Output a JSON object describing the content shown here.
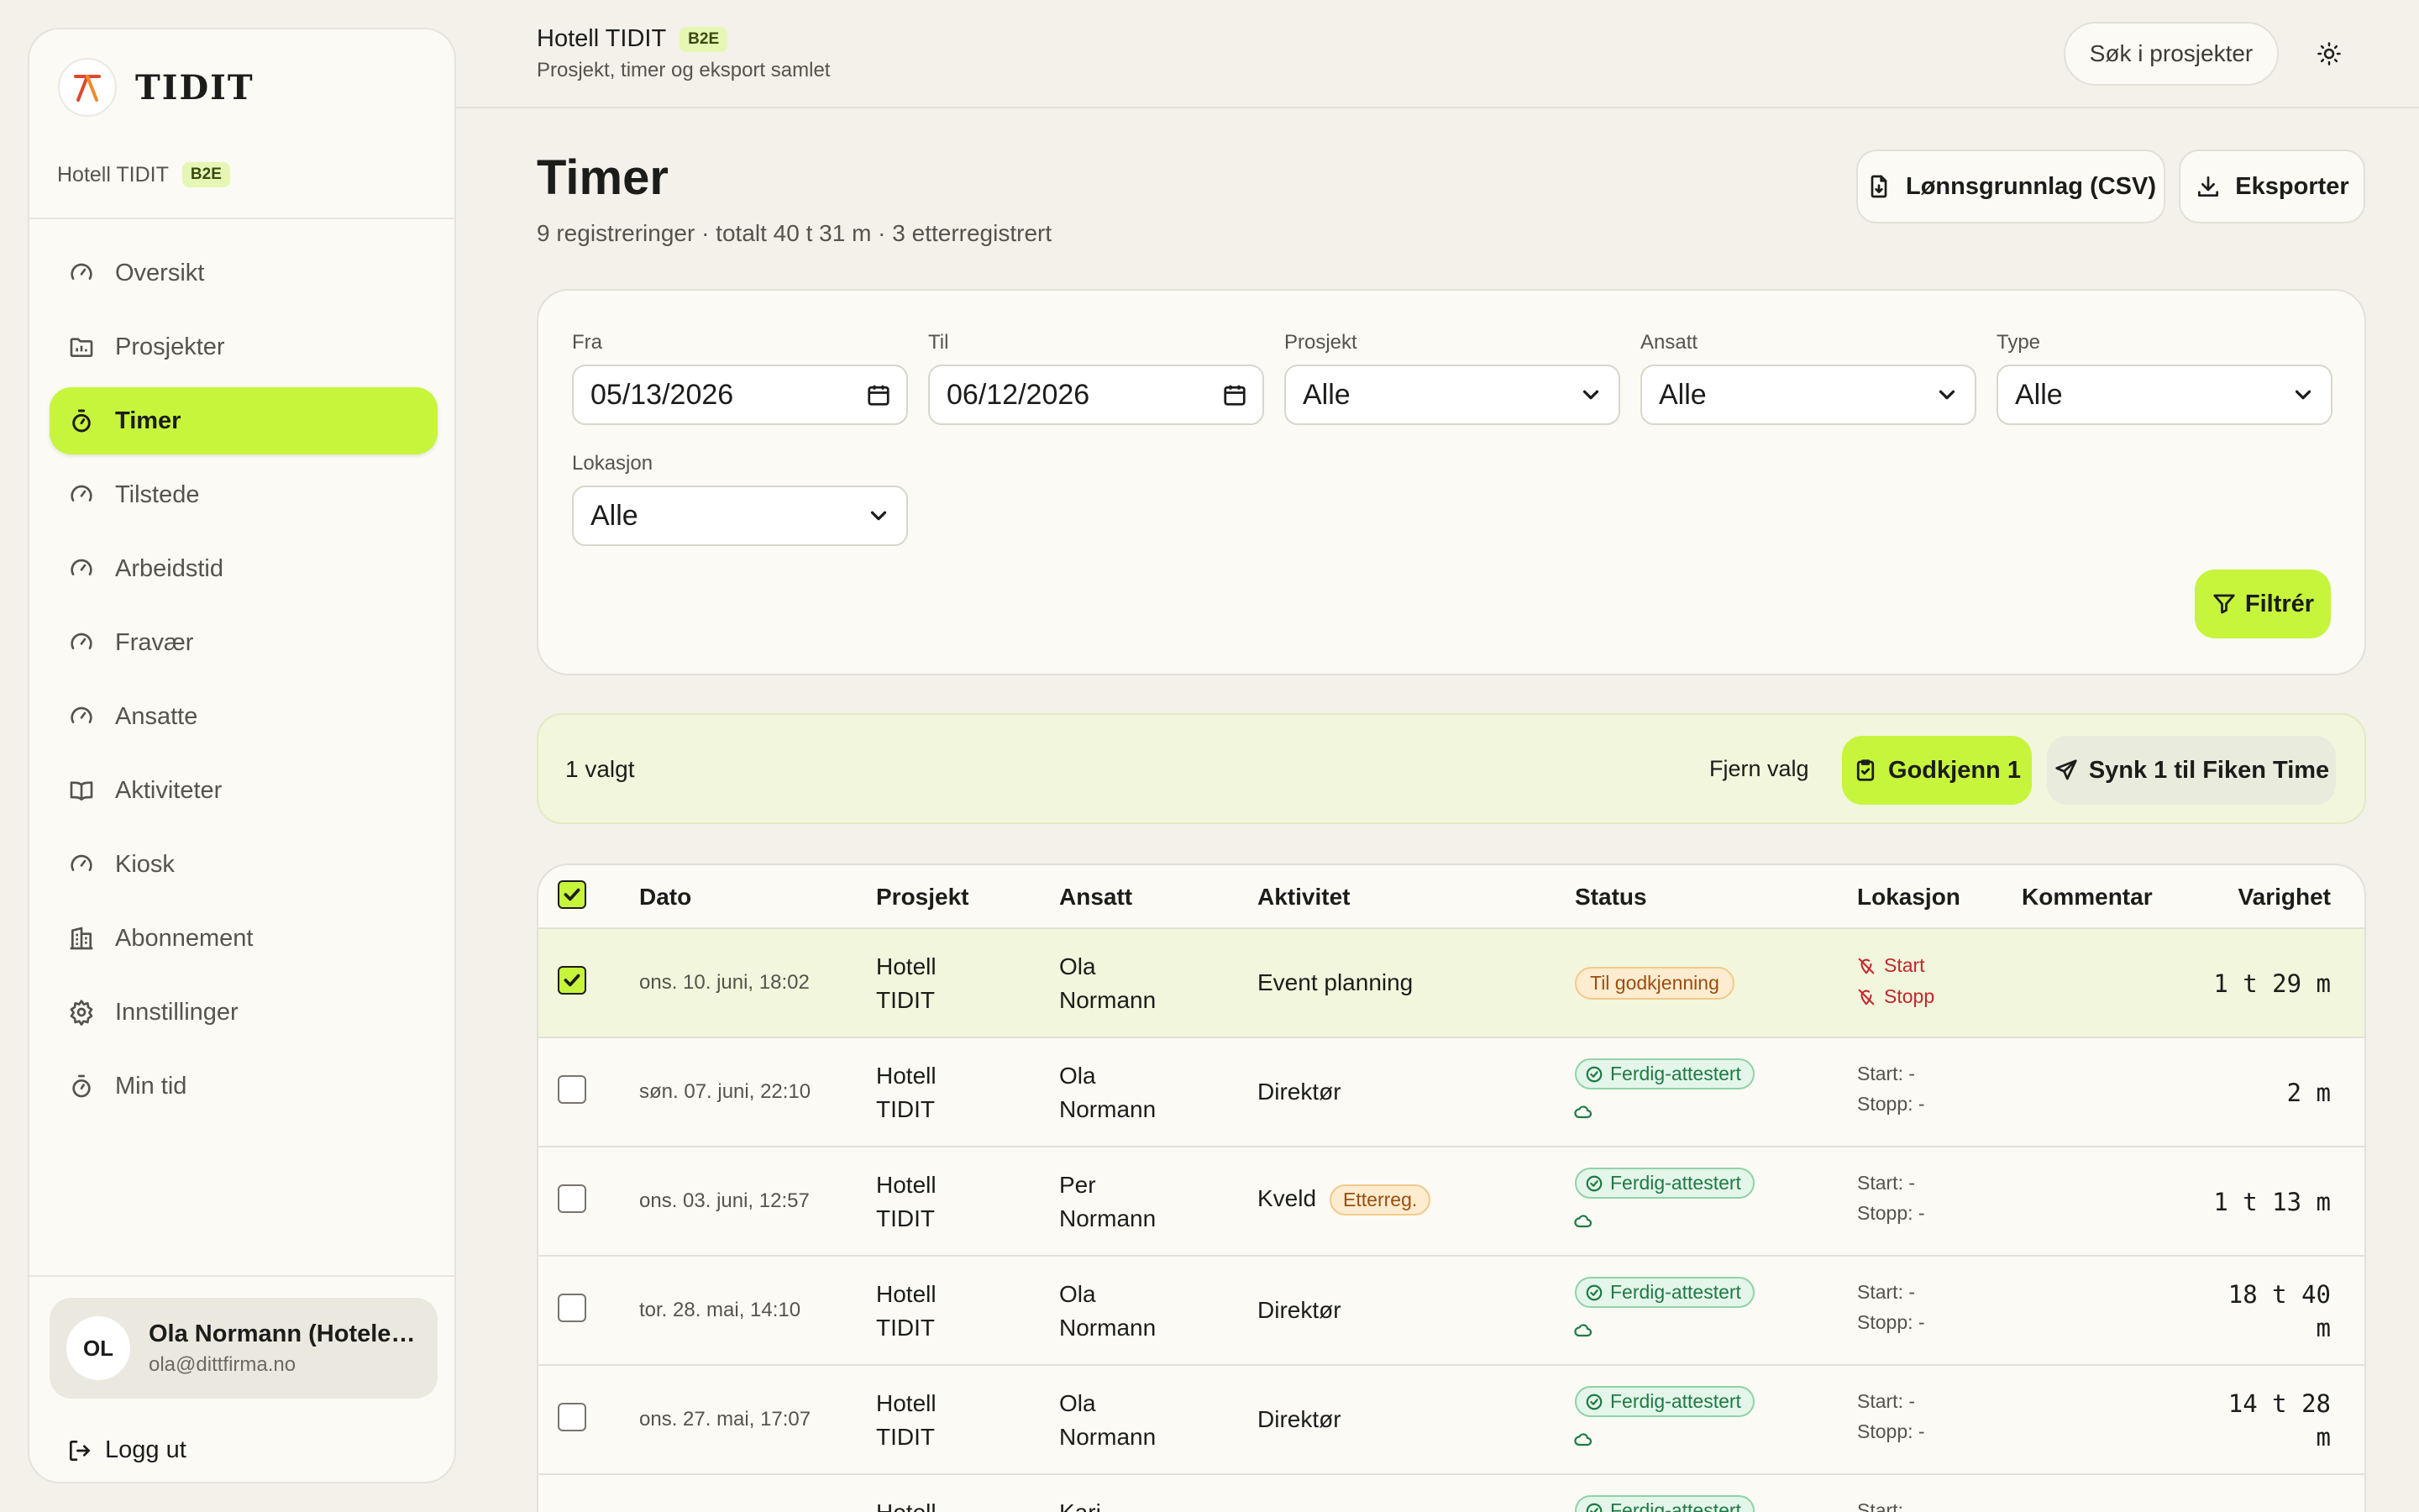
{
  "brand": {
    "name": "TIDIT",
    "org": "Hotell TIDIT",
    "badge": "B2E"
  },
  "sidebar": {
    "items": [
      {
        "label": "Oversikt",
        "icon": "gauge-icon"
      },
      {
        "label": "Prosjekter",
        "icon": "folder-chart-icon"
      },
      {
        "label": "Timer",
        "icon": "timer-icon",
        "active": true
      },
      {
        "label": "Tilstede",
        "icon": "gauge-icon"
      },
      {
        "label": "Arbeidstid",
        "icon": "gauge-icon"
      },
      {
        "label": "Fravær",
        "icon": "gauge-icon"
      },
      {
        "label": "Ansatte",
        "icon": "gauge-icon"
      },
      {
        "label": "Aktiviteter",
        "icon": "book-open-icon"
      },
      {
        "label": "Kiosk",
        "icon": "gauge-icon"
      },
      {
        "label": "Abonnement",
        "icon": "building-icon"
      },
      {
        "label": "Innstillinger",
        "icon": "gear-icon"
      },
      {
        "label": "Min tid",
        "icon": "timer-icon"
      }
    ],
    "user": {
      "initials": "OL",
      "name": "Ola Normann (Hotelei...",
      "email": "ola@dittfirma.no"
    },
    "logout_label": "Logg ut"
  },
  "topbar": {
    "title": "Hotell TIDIT",
    "badge": "B2E",
    "subtitle": "Prosjekt, timer og eksport samlet",
    "search_label": "Søk i prosjekter"
  },
  "page": {
    "title": "Timer",
    "subtitle": "9 registreringer · totalt 40 t 31 m · 3 etterregistrert",
    "payroll_button": "Lønnsgrunnlag (CSV)",
    "export_button": "Eksporter"
  },
  "filters": {
    "from_label": "Fra",
    "from_value": "05/13/2026",
    "to_label": "Til",
    "to_value": "06/12/2026",
    "project_label": "Prosjekt",
    "project_value": "Alle",
    "employee_label": "Ansatt",
    "employee_value": "Alle",
    "type_label": "Type",
    "type_value": "Alle",
    "location_label": "Lokasjon",
    "location_value": "Alle",
    "filter_button": "Filtrér"
  },
  "bulk": {
    "selected_text": "1 valgt",
    "clear_label": "Fjern valg",
    "approve_label": "Godkjenn 1",
    "sync_label": "Synk 1 til Fiken Time"
  },
  "table": {
    "columns": [
      "Dato",
      "Prosjekt",
      "Ansatt",
      "Aktivitet",
      "Status",
      "Lokasjon",
      "Kommentar",
      "Varighet"
    ],
    "rows": [
      {
        "date": "ons. 10. juni, 18:02",
        "project_l1": "Hotell",
        "project_l2": "TIDIT",
        "emp_l1": "Ola",
        "emp_l2": "Normann",
        "activity": "Event planning",
        "tag": "",
        "status": "Til godkjenning",
        "loc_start": "Start",
        "loc_stop": "Stopp",
        "comment": "",
        "dur_l1": "1 t 29 m",
        "dur_l2": ""
      },
      {
        "date": "søn. 07. juni, 22:10",
        "project_l1": "Hotell",
        "project_l2": "TIDIT",
        "emp_l1": "Ola",
        "emp_l2": "Normann",
        "activity": "Direktør",
        "tag": "",
        "status": "Ferdig-attestert",
        "loc_start": "Start: -",
        "loc_stop": "Stopp: -",
        "comment": "",
        "dur_l1": "2 m",
        "dur_l2": ""
      },
      {
        "date": "ons. 03. juni, 12:57",
        "project_l1": "Hotell",
        "project_l2": "TIDIT",
        "emp_l1": "Per",
        "emp_l2": "Normann",
        "activity": "Kveld",
        "tag": "Etterreg.",
        "status": "Ferdig-attestert",
        "loc_start": "Start: -",
        "loc_stop": "Stopp: -",
        "comment": "",
        "dur_l1": "1 t 13 m",
        "dur_l2": ""
      },
      {
        "date": "tor. 28. mai, 14:10",
        "project_l1": "Hotell",
        "project_l2": "TIDIT",
        "emp_l1": "Ola",
        "emp_l2": "Normann",
        "activity": "Direktør",
        "tag": "",
        "status": "Ferdig-attestert",
        "loc_start": "Start: -",
        "loc_stop": "Stopp: -",
        "comment": "",
        "dur_l1": "18 t 40",
        "dur_l2": "m"
      },
      {
        "date": "ons. 27. mai, 17:07",
        "project_l1": "Hotell",
        "project_l2": "TIDIT",
        "emp_l1": "Ola",
        "emp_l2": "Normann",
        "activity": "Direktør",
        "tag": "",
        "status": "Ferdig-attestert",
        "loc_start": "Start: -",
        "loc_stop": "Stopp: -",
        "comment": "",
        "dur_l1": "14 t 28",
        "dur_l2": "m"
      },
      {
        "date": "",
        "project_l1": "Hotell",
        "project_l2": "",
        "emp_l1": "Kari",
        "emp_l2": "",
        "activity": "",
        "tag": "",
        "status": "Ferdig-attestert",
        "loc_start": "Start:",
        "loc_stop": "",
        "comment": "",
        "dur_l1": "",
        "dur_l2": ""
      }
    ]
  },
  "colors": {
    "accent": "#c6f53c",
    "pending": "#9a4d10",
    "done": "#1e7a45",
    "location_missing": "#c2262c"
  }
}
